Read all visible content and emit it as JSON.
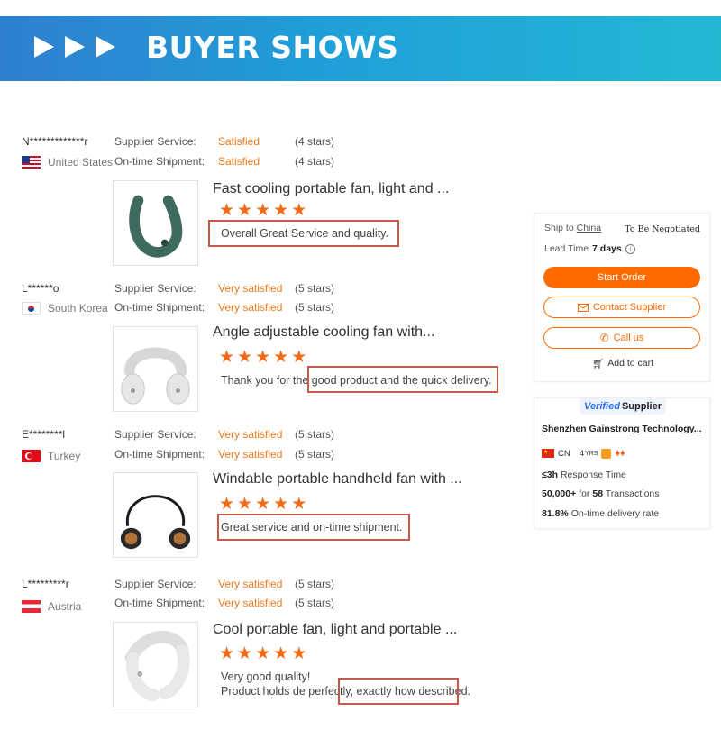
{
  "banner": {
    "title": "BUYER SHOWS"
  },
  "reviews": [
    {
      "buyer": "N*************r",
      "country": "United States",
      "supplier_service_label": "Supplier Service:",
      "supplier_service_value": "Satisfied",
      "supplier_service_stars": "(4 stars)",
      "shipment_label": "On-time Shipment:",
      "shipment_value": "Satisfied",
      "shipment_stars": "(4 stars)",
      "product_title": "Fast cooling portable fan, light and ...",
      "rating": 5,
      "comment": "Overall Great Service and quality."
    },
    {
      "buyer": "L******o",
      "country": "South Korea",
      "supplier_service_label": "Supplier Service:",
      "supplier_service_value": "Very satisfied",
      "supplier_service_stars": "(5 stars)",
      "shipment_label": "On-time Shipment:",
      "shipment_value": "Very satisfied",
      "shipment_stars": "(5 stars)",
      "product_title": "Angle adjustable cooling fan with...",
      "rating": 5,
      "comment": "Thank you for the good product and the quick delivery."
    },
    {
      "buyer": "E********l",
      "country": "Turkey",
      "supplier_service_label": "Supplier Service:",
      "supplier_service_value": "Very satisfied",
      "supplier_service_stars": "(5 stars)",
      "shipment_label": "On-time Shipment:",
      "shipment_value": "Very satisfied",
      "shipment_stars": "(5 stars)",
      "product_title": "Windable portable handheld fan with ...",
      "rating": 5,
      "comment": "Great service and on-time shipment."
    },
    {
      "buyer": "L*********r",
      "country": "Austria",
      "supplier_service_label": "Supplier Service:",
      "supplier_service_value": "Very satisfied",
      "supplier_service_stars": "(5 stars)",
      "shipment_label": "On-time Shipment:",
      "shipment_value": "Very satisfied",
      "shipment_stars": "(5 stars)",
      "product_title": "Cool portable fan, light and portable ...",
      "rating": 5,
      "comment_line1": "Very good quality!",
      "comment_line2": "Product holds de perfectly, exactly how described."
    }
  ],
  "order_card": {
    "ship_to_label": "Ship to",
    "ship_to_value": "China",
    "price": "To Be Negotiated",
    "lead_time_label": "Lead Time",
    "lead_time_value": "7 days",
    "start_order": "Start Order",
    "contact_supplier": "Contact Supplier",
    "call_us": "Call us",
    "add_to_cart": "Add to cart"
  },
  "supplier_card": {
    "verified_prefix": "Verified",
    "verified_suffix": "Supplier",
    "name": "Shenzhen Gainstrong Technology...",
    "country_code": "CN",
    "years": "4",
    "years_unit": "YRS",
    "response_value": "≤3h",
    "response_label": "Response Time",
    "transactions_value": "50,000+",
    "transactions_mid": "for",
    "transactions_count": "58",
    "transactions_label": "Transactions",
    "delivery_rate": "81.8%",
    "delivery_label": "On-time delivery rate"
  },
  "colors": {
    "accent": "#ff6a00",
    "highlight_box": "#c9584a",
    "banner_start": "#2f7fd0",
    "banner_end": "#22b8d4"
  }
}
